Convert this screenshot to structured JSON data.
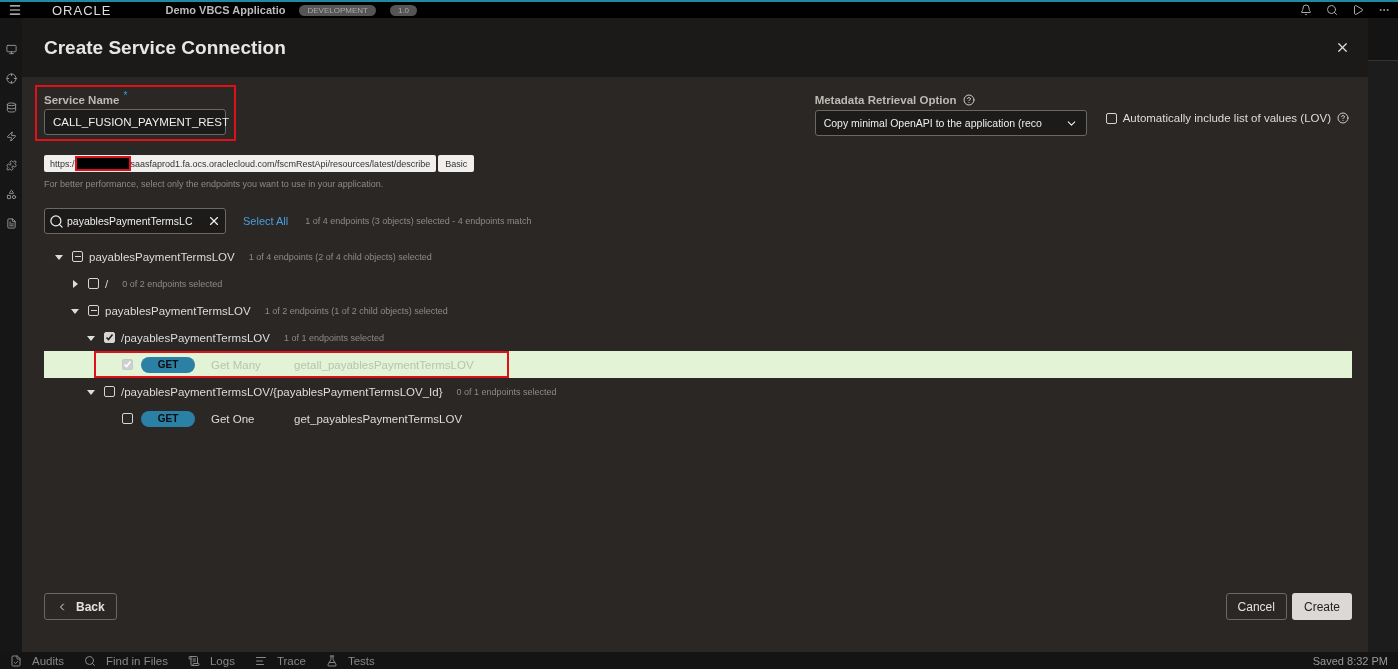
{
  "app_bar": {
    "logo": "ORACLE",
    "title": "Demo VBCS Applicatio",
    "badges": [
      "DEVELOPMENT",
      "1.0"
    ]
  },
  "dialog": {
    "title": "Create Service Connection",
    "service_name": {
      "label": "Service Name",
      "required_mark": "*",
      "value": "CALL_FUSION_PAYMENT_REST",
      "annotated": true
    },
    "metadata": {
      "label": "Metadata Retrieval Option",
      "value": "Copy minimal OpenAPI to the application (reco"
    },
    "lov_option": {
      "label": "Automatically include list of values (LOV)",
      "checked": false
    },
    "url": {
      "prefix": "https:/",
      "redacted": true,
      "rest": "saasfaprod1.fa.ocs.oraclecloud.com/fscmRestApi/resources/latest/describe",
      "auth": "Basic"
    },
    "hint": "For better performance, select only the endpoints you want to use in your application.",
    "search": {
      "value": "payablesPaymentTermsLC"
    },
    "select_all": "Select All",
    "match_summary": "1 of 4 endpoints (3 objects) selected - 4 endpoints match",
    "tree": [
      {
        "kind": "node",
        "label": "payablesPaymentTermsLOV",
        "summary": "1 of 4 endpoints (2 of 4 child objects) selected",
        "expanded": true,
        "checked": false,
        "partial": true,
        "children": [
          {
            "kind": "node",
            "label": "/",
            "summary": "0 of 2 endpoints selected",
            "expanded": false,
            "checked": false,
            "partial": false
          },
          {
            "kind": "node",
            "label": "payablesPaymentTermsLOV",
            "summary": "1 of 2 endpoints (1 of 2 child objects) selected",
            "expanded": true,
            "checked": false,
            "partial": true,
            "children": [
              {
                "kind": "node",
                "label": "/payablesPaymentTermsLOV",
                "summary": "1 of 1 endpoints selected",
                "expanded": true,
                "checked": true,
                "partial": false,
                "children": [
                  {
                    "kind": "endpoint",
                    "method": "GET",
                    "name": "Get Many",
                    "operation": "getall_payablesPaymentTermsLOV",
                    "checked": true,
                    "disabled": true,
                    "selected": true,
                    "annotated": true
                  }
                ]
              },
              {
                "kind": "node",
                "label": "/payablesPaymentTermsLOV/{payablesPaymentTermsLOV_Id}",
                "summary": "0 of 1 endpoints selected",
                "expanded": true,
                "checked": false,
                "partial": false,
                "children": [
                  {
                    "kind": "endpoint",
                    "method": "GET",
                    "name": "Get One",
                    "operation": "get_payablesPaymentTermsLOV",
                    "checked": false,
                    "disabled": false,
                    "selected": false,
                    "annotated": false
                  }
                ]
              }
            ]
          }
        ]
      }
    ],
    "buttons": {
      "back": "Back",
      "cancel": "Cancel",
      "create": "Create"
    }
  },
  "status_bar": {
    "tabs": [
      {
        "kind": "audits",
        "label": "Audits"
      },
      {
        "kind": "find",
        "label": "Find in Files"
      },
      {
        "kind": "logs",
        "label": "Logs"
      },
      {
        "kind": "trace",
        "label": "Trace"
      },
      {
        "kind": "tests",
        "label": "Tests"
      }
    ],
    "saved": "Saved 8:32 PM"
  }
}
